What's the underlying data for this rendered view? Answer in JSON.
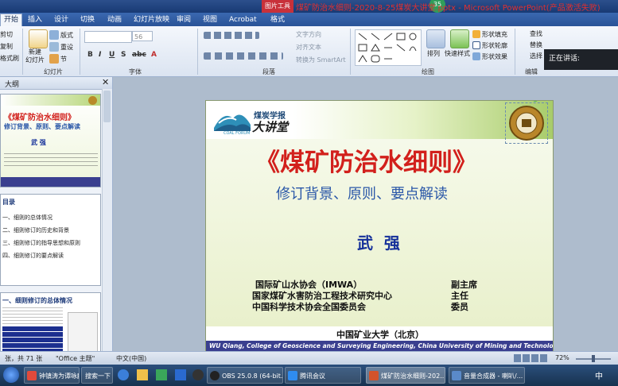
{
  "titlebar": {
    "context_tools": "图片工具",
    "badge": "35",
    "title": "煤矿防治水细则-2020-8-25煤炭大讲堂.pptx - Microsoft PowerPoint(产品激活失败)"
  },
  "tabs": [
    "开始",
    "插入",
    "设计",
    "切换",
    "动画",
    "幻灯片放映",
    "审阅",
    "视图",
    "Acrobat",
    "格式"
  ],
  "ribbon": {
    "clipboard": {
      "cut": "剪切",
      "copy": "复制",
      "paste_format": "格式刷"
    },
    "slides": {
      "new_slide": "新建\n幻灯片",
      "layout": "版式",
      "reset": "重设",
      "section": "节",
      "group_label": "幻灯片"
    },
    "font": {
      "font_size": "56",
      "group_label": "字体"
    },
    "paragraph": {
      "text_direction": "文字方向",
      "align_text": "对齐文本",
      "smartart": "转换为 SmartArt",
      "group_label": "段落"
    },
    "drawing": {
      "arrange": "排列",
      "quick_styles": "快速样式",
      "shape_fill": "形状填充",
      "shape_outline": "形状轮廓",
      "shape_effects": "形状效果",
      "group_label": "绘图"
    },
    "editing": {
      "find": "查找",
      "replace": "替换",
      "select": "选择",
      "group_label": "编辑"
    },
    "popup": "正在讲话:"
  },
  "left_pane": {
    "tab_label": "大纲",
    "thumb1": {
      "title": "《煤矿防治水细则》",
      "subtitle": "修订背景、原则、要点解读",
      "author": "武  强"
    },
    "thumb2": {
      "heading": "目录",
      "items": [
        "一、细则的总体情况",
        "二、细则修订的历史和背景",
        "三、细则修订的指导思想和原则",
        "四、细则修订的要点解读"
      ]
    },
    "thumb3": {
      "heading": "一、细则修订的总体情况"
    }
  },
  "slide": {
    "logo_top": "煤炭学报",
    "logo_main": "大讲堂",
    "logo_sub": "COAL FORUM",
    "title": "《煤矿防治水细则》",
    "subtitle": "修订背景、原则、要点解读",
    "author": "武  强",
    "affiliations": [
      {
        "org": "国际矿山水协会（IMWA）",
        "role": "副主席"
      },
      {
        "org": "国家煤矿水害防治工程技术研究中心",
        "role": "主任"
      },
      {
        "org": "中国科学技术协会全国委员会",
        "role": "委员"
      }
    ],
    "university": "中国矿业大学（北京）",
    "footer": "WU Qiang, College of Geoscience and Surveying Engineering, China University of Mining and Technology, Beijing"
  },
  "status": {
    "slide_pos": "张，共 71 张",
    "theme": "\"Office 主题\"",
    "lang": "中文(中国)",
    "zoom": "72%"
  },
  "taskbar": {
    "items": [
      "钟镇涛为谭咏麟...",
      "搜索一下",
      "OBS 25.0.8 (64-bit...",
      "腾讯会议",
      "煤矿防治水细则-202...",
      "音量合成器 - 喇叭/..."
    ],
    "ime": "中"
  },
  "colors": {
    "title_red": "#d2201c",
    "subtitle_blue": "#2a57a8",
    "author_blue": "#15309a"
  }
}
